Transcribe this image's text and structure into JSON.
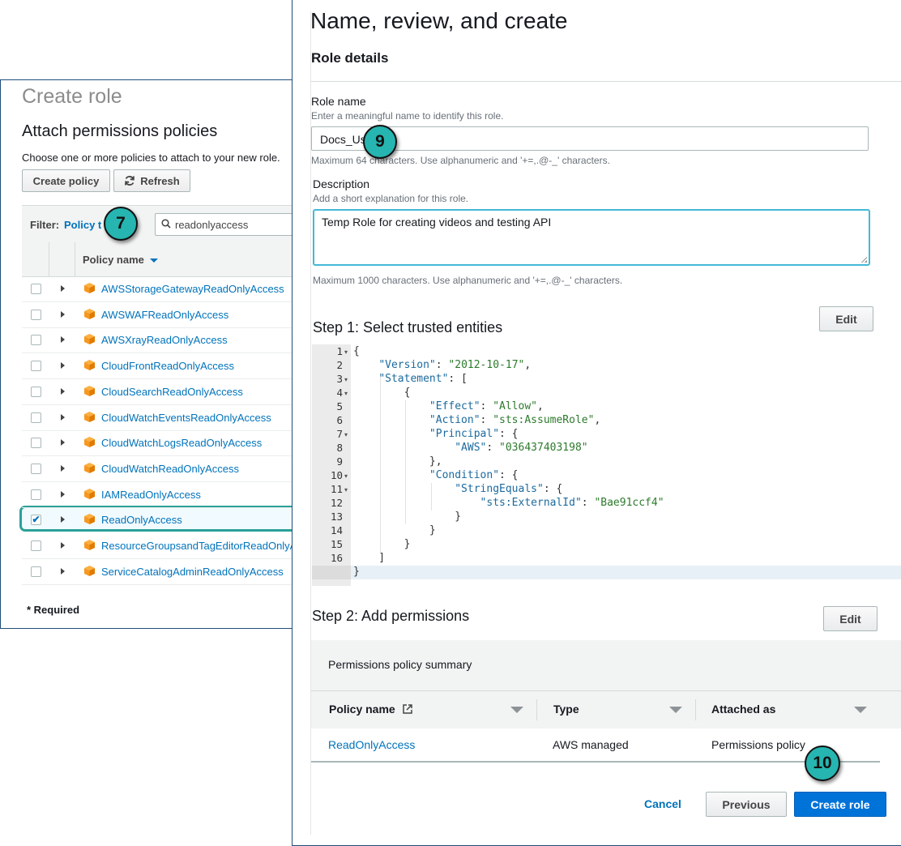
{
  "left": {
    "title": "Create role",
    "heading": "Attach permissions policies",
    "description": "Choose one or more policies to attach to your new role.",
    "create_policy": "Create policy",
    "refresh": "Refresh",
    "filter_label": "Filter:",
    "filter_link": "Policy t",
    "search_value": "readonlyaccess",
    "column_policy_name": "Policy name",
    "policies": [
      {
        "name": "AWSStorageGatewayReadOnlyAccess",
        "checked": false
      },
      {
        "name": "AWSWAFReadOnlyAccess",
        "checked": false
      },
      {
        "name": "AWSXrayReadOnlyAccess",
        "checked": false
      },
      {
        "name": "CloudFrontReadOnlyAccess",
        "checked": false
      },
      {
        "name": "CloudSearchReadOnlyAccess",
        "checked": false
      },
      {
        "name": "CloudWatchEventsReadOnlyAccess",
        "checked": false
      },
      {
        "name": "CloudWatchLogsReadOnlyAccess",
        "checked": false
      },
      {
        "name": "CloudWatchReadOnlyAccess",
        "checked": false
      },
      {
        "name": "IAMReadOnlyAccess",
        "checked": false
      },
      {
        "name": "ReadOnlyAccess",
        "checked": true
      },
      {
        "name": "ResourceGroupsandTagEditorReadOnlyA",
        "checked": false
      },
      {
        "name": "ServiceCatalogAdminReadOnlyAccess",
        "checked": false
      }
    ],
    "required_note": "* Required"
  },
  "callouts": {
    "c7": "7",
    "c9": "9",
    "c10": "10"
  },
  "right": {
    "title": "Name, review, and create",
    "section": "Role details",
    "role_name_label": "Role name",
    "role_name_hint": "Enter a meaningful name to identify this role.",
    "role_name_value": "Docs_Us",
    "role_name_limit": "Maximum 64 characters. Use alphanumeric and '+=,.@-_' characters.",
    "description_label": "Description",
    "description_hint": "Add a short explanation for this role.",
    "description_value": "Temp Role for creating videos and testing API",
    "description_limit": "Maximum 1000 characters. Use alphanumeric and '+=,.@-_' characters.",
    "step1": "Step 1: Select trusted entities",
    "edit": "Edit",
    "code_lines": [
      "{",
      "    \"Version\": \"2012-10-17\",",
      "    \"Statement\": [",
      "        {",
      "            \"Effect\": \"Allow\",",
      "            \"Action\": \"sts:AssumeRole\",",
      "            \"Principal\": {",
      "                \"AWS\": \"036437403198\"",
      "            },",
      "            \"Condition\": {",
      "                \"StringEquals\": {",
      "                    \"sts:ExternalId\": \"Bae91ccf4\"",
      "                }",
      "            }",
      "        }",
      "    ]",
      "}"
    ],
    "fold_lines": [
      1,
      3,
      4,
      7,
      10,
      11
    ],
    "step2": "Step 2: Add permissions",
    "summary_title": "Permissions policy summary",
    "col_policy_name": "Policy name",
    "col_type": "Type",
    "col_attached": "Attached as",
    "row_policy": "ReadOnlyAccess",
    "row_type": "AWS managed",
    "row_attached": "Permissions policy",
    "cancel": "Cancel",
    "previous": "Previous",
    "create_role": "Create role"
  },
  "colors": {
    "accent_teal": "#26b5b0",
    "link_blue": "#0073bb",
    "primary_button": "#0073d9",
    "aws_orange": "#f7981f"
  },
  "icons": [
    "search-icon",
    "refresh-icon",
    "policy-box-icon",
    "external-link-icon",
    "sort-arrow-icon",
    "expand-arrow-icon",
    "checkbox-icon",
    "fold-arrow-icon"
  ]
}
